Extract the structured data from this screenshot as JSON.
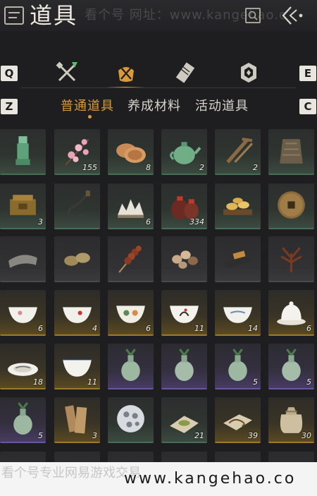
{
  "header": {
    "title": "道具",
    "watermark": "看个号  网址：www.kangehao.c",
    "search_icon": "search-icon",
    "back_icon": "back-arrow-icon"
  },
  "category_bar": {
    "left_key": "Q",
    "right_key": "E",
    "categories": [
      {
        "icon": "weapon-icon",
        "active": false
      },
      {
        "icon": "item-bag-icon",
        "active": true
      },
      {
        "icon": "scroll-icon",
        "active": false
      },
      {
        "icon": "medal-icon",
        "active": false
      }
    ]
  },
  "tabs": {
    "left_key": "Z",
    "right_key": "C",
    "items": [
      {
        "label": "普通道具",
        "active": true
      },
      {
        "label": "养成材料",
        "active": false
      },
      {
        "label": "活动道具",
        "active": false
      }
    ]
  },
  "items": [
    {
      "name": "jade-seal",
      "count": "",
      "rarity": "green"
    },
    {
      "name": "plum-blossom",
      "count": "155",
      "rarity": "green"
    },
    {
      "name": "flatbread",
      "count": "8",
      "rarity": "green"
    },
    {
      "name": "green-teapot",
      "count": "2",
      "rarity": "green"
    },
    {
      "name": "wooden-frame",
      "count": "2",
      "rarity": "green"
    },
    {
      "name": "armor-vest",
      "count": "",
      "rarity": "green"
    },
    {
      "name": "bronze-box",
      "count": "3",
      "rarity": "green"
    },
    {
      "name": "whip",
      "count": "",
      "rarity": "green"
    },
    {
      "name": "brush-rest",
      "count": "6",
      "rarity": "green"
    },
    {
      "name": "wine-jars",
      "count": "334",
      "rarity": "green"
    },
    {
      "name": "cakes-tray",
      "count": "",
      "rarity": "green"
    },
    {
      "name": "bronze-coin",
      "count": "",
      "rarity": "green"
    },
    {
      "name": "stone-pillow",
      "count": "",
      "rarity": "gray"
    },
    {
      "name": "straw-sandals",
      "count": "",
      "rarity": "gray"
    },
    {
      "name": "candied-haws",
      "count": "",
      "rarity": "gray"
    },
    {
      "name": "mushrooms",
      "count": "",
      "rarity": "gray"
    },
    {
      "name": "ink-stick",
      "count": "",
      "rarity": "gray"
    },
    {
      "name": "dried-herb",
      "count": "",
      "rarity": "gray"
    },
    {
      "name": "porcelain-bowl-pink",
      "count": "6",
      "rarity": "gold"
    },
    {
      "name": "porcelain-bowl-red",
      "count": "4",
      "rarity": "gold"
    },
    {
      "name": "porcelain-bowl-flower",
      "count": "6",
      "rarity": "gold"
    },
    {
      "name": "porcelain-bowl-rooster",
      "count": "11",
      "rarity": "gold"
    },
    {
      "name": "porcelain-bowl-blue",
      "count": "14",
      "rarity": "gold"
    },
    {
      "name": "covered-bowl",
      "count": "6",
      "rarity": "gold"
    },
    {
      "name": "porcelain-plate",
      "count": "18",
      "rarity": "gold"
    },
    {
      "name": "porcelain-bowl-plain",
      "count": "11",
      "rarity": "gold"
    },
    {
      "name": "celadon-vase-1",
      "count": "",
      "rarity": "purple"
    },
    {
      "name": "celadon-vase-2",
      "count": "",
      "rarity": "purple"
    },
    {
      "name": "celadon-vase-3",
      "count": "5",
      "rarity": "purple"
    },
    {
      "name": "celadon-vase-4",
      "count": "5",
      "rarity": "purple"
    },
    {
      "name": "celadon-vase-5",
      "count": "5",
      "rarity": "purple"
    },
    {
      "name": "bamboo-slips",
      "count": "3",
      "rarity": "gold"
    },
    {
      "name": "carved-ball",
      "count": "",
      "rarity": "green"
    },
    {
      "name": "tea-powder",
      "count": "21",
      "rarity": "green"
    },
    {
      "name": "rope-cloth",
      "count": "39",
      "rarity": "gold"
    },
    {
      "name": "cloth-sack",
      "count": "30",
      "rarity": "gold"
    }
  ],
  "footer": {
    "watermark_text": "看个号专业网易游戏交易",
    "url": "www.kangehao.co"
  },
  "colors": {
    "background": "#1e1e20",
    "accent": "#d99b3a",
    "rarity_green": "#4a6b54",
    "rarity_gold": "#9c7a2c",
    "rarity_purple": "#6a55a0"
  }
}
